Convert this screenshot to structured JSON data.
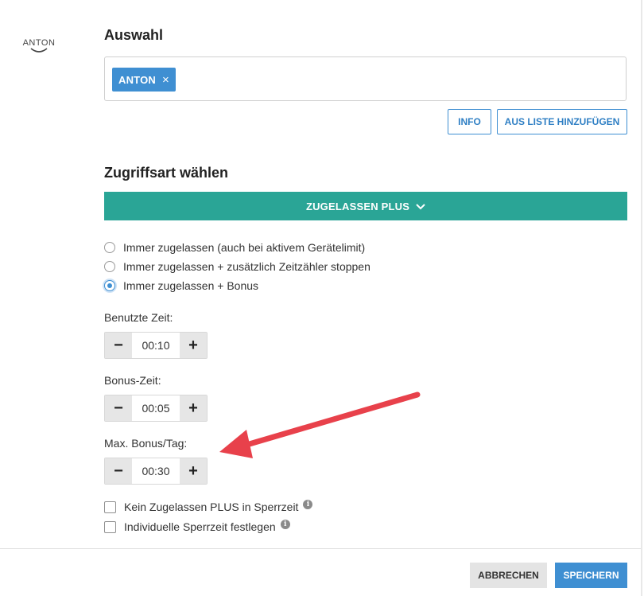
{
  "app": {
    "logo_text": "ANTON"
  },
  "selection": {
    "heading": "Auswahl",
    "chip_label": "ANTON",
    "chip_remove_icon": "close-icon",
    "info_button": "INFO",
    "add_from_list_button": "AUS LISTE HINZUFÜGEN"
  },
  "access": {
    "heading": "Zugriffsart wählen",
    "dropdown_label": "ZUGELASSEN PLUS",
    "options": [
      {
        "label": "Immer zugelassen (auch bei aktivem Gerätelimit)",
        "selected": false
      },
      {
        "label": "Immer zugelassen + zusätzlich Zeitzähler stoppen",
        "selected": false
      },
      {
        "label": "Immer zugelassen + Bonus",
        "selected": true
      }
    ]
  },
  "time_fields": [
    {
      "label": "Benutzte Zeit:",
      "value": "00:10"
    },
    {
      "label": "Bonus-Zeit:",
      "value": "00:05"
    },
    {
      "label": "Max. Bonus/Tag:",
      "value": "00:30"
    }
  ],
  "stepper": {
    "minus": "−",
    "plus": "+"
  },
  "checkboxes": [
    {
      "label": "Kein Zugelassen PLUS in Sperrzeit",
      "checked": false,
      "info_icon": "i"
    },
    {
      "label": "Individuelle Sperrzeit festlegen",
      "checked": false,
      "info_icon": "i"
    }
  ],
  "footer": {
    "cancel_button": "ABBRECHEN",
    "save_button": "SPEICHERN"
  },
  "colors": {
    "primary": "#3f8fd2",
    "teal": "#2aa596",
    "arrow": "#e8414b"
  }
}
